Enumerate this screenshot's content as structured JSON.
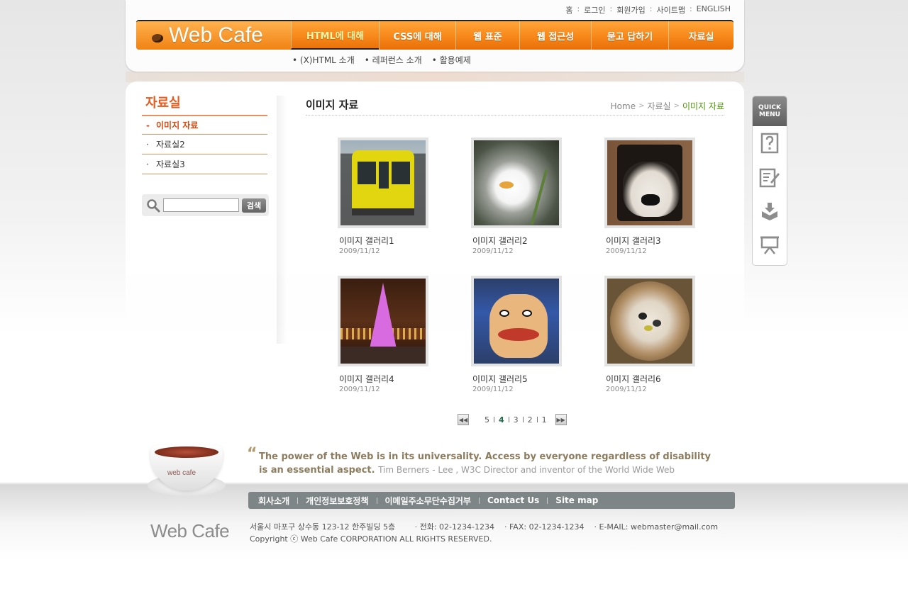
{
  "util_nav": [
    "홈",
    "로그인",
    "회원가입",
    "사이트맵",
    "ENGLISH"
  ],
  "logo": "Web Cafe",
  "gnb": [
    {
      "label": "HTML에 대해",
      "active": true
    },
    {
      "label": "CSS에 대해",
      "active": false
    },
    {
      "label": "웹 표준",
      "active": false
    },
    {
      "label": "웹 접근성",
      "active": false
    },
    {
      "label": "묻고 답하기",
      "active": false
    },
    {
      "label": "자료실",
      "active": false
    }
  ],
  "sub_nav": [
    "• (X)HTML 소개",
    "• 레퍼런스 소개",
    "• 활용예제"
  ],
  "lnb": {
    "title": "자료실",
    "items": [
      {
        "label": "이미지 자료",
        "active": true
      },
      {
        "label": "자료실2",
        "active": false
      },
      {
        "label": "자료실3",
        "active": false
      }
    ]
  },
  "search": {
    "value": "",
    "button": "검색"
  },
  "main": {
    "title": "이미지 자료",
    "breadcrumb": [
      "Home",
      "자료실",
      "이미지 자료"
    ]
  },
  "gallery": [
    {
      "title": "이미지 갤러리1",
      "date": "2009/11/12",
      "thumb": "train"
    },
    {
      "title": "이미지 갤러리2",
      "date": "2009/11/12",
      "thumb": "duck"
    },
    {
      "title": "이미지 갤러리3",
      "date": "2009/11/12",
      "thumb": "dog"
    },
    {
      "title": "이미지 갤러리4",
      "date": "2009/11/12",
      "thumb": "tree"
    },
    {
      "title": "이미지 갤러리5",
      "date": "2009/11/12",
      "thumb": "mask"
    },
    {
      "title": "이미지 갤러리6",
      "date": "2009/11/12",
      "thumb": "bowl"
    }
  ],
  "pagination": {
    "pages": [
      "5",
      "4",
      "3",
      "2",
      "1"
    ],
    "current": "4"
  },
  "footer": {
    "cup_label": "web cafe",
    "quote": "The power of the Web is in its universality. Access by everyone regardless of disability is an essential aspect.",
    "quote_author": "Tim Berners - Lee , W3C Director and inventor of the World Wide Web",
    "nav": [
      "회사소개",
      "개인정보보호정책",
      "이메일주소무단수집거부",
      "Contact Us",
      "Site map"
    ],
    "logo": "Web Cafe",
    "address": "서울시 마포구 상수동 123-12 한주빌딩 5층",
    "phone": "· 전화: 02-1234-1234",
    "fax": "· FAX: 02-1234-1234",
    "email": "· E-MAIL: webmaster@mail.com",
    "copyright": "Copyright ⓒ Web Cafe CORPORATION ALL RIGHTS RESERVED."
  },
  "quick_menu": {
    "title_line1": "QUICK",
    "title_line2": "MENU",
    "icons": [
      "question-icon",
      "memo-edit-icon",
      "download-icon",
      "presentation-icon"
    ]
  }
}
